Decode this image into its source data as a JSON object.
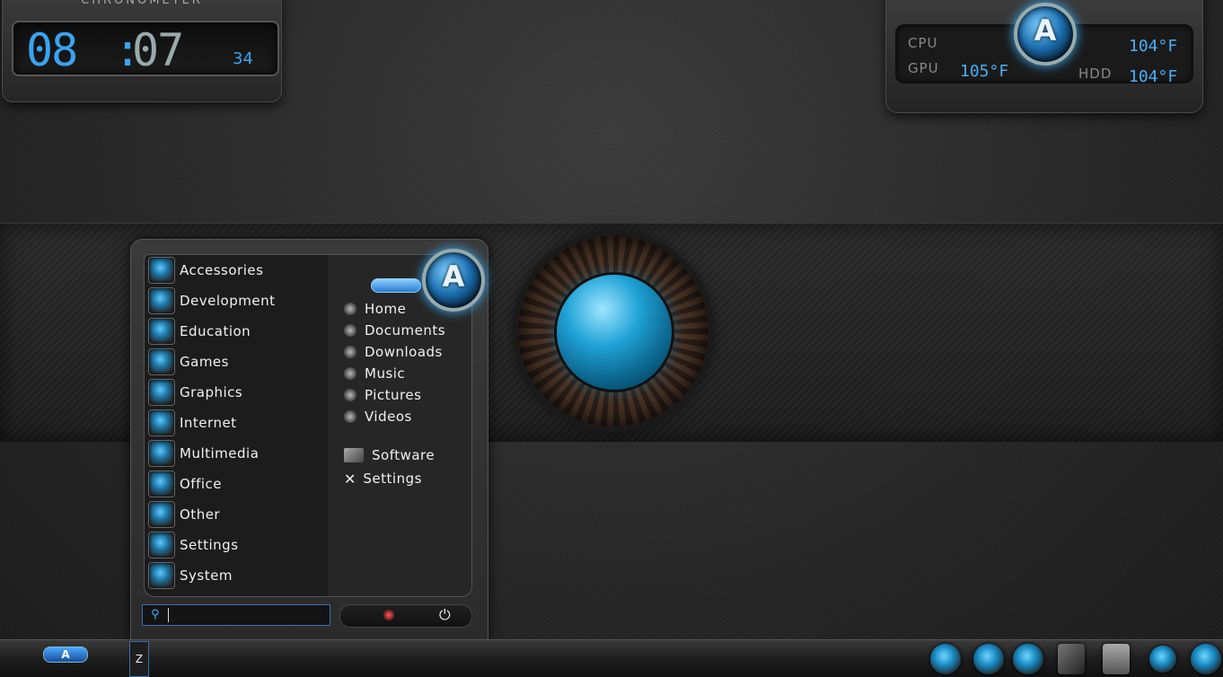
{
  "clock": {
    "title": "CHRONOMETER",
    "hours": "08",
    "separator": ":",
    "minutes": "07",
    "seconds": "34"
  },
  "temps": {
    "cpu_label": "CPU",
    "cpu_value": "104°F",
    "gpu_label": "GPU",
    "gpu_value": "105°F",
    "hdd_label": "HDD",
    "hdd_value": "104°F",
    "logo_letter": "A"
  },
  "menu": {
    "categories": [
      {
        "label": "Accessories",
        "icon": "accessories-icon"
      },
      {
        "label": "Development",
        "icon": "development-icon"
      },
      {
        "label": "Education",
        "icon": "education-icon"
      },
      {
        "label": "Games",
        "icon": "gamepad-icon"
      },
      {
        "label": "Graphics",
        "icon": "graphics-icon"
      },
      {
        "label": "Internet",
        "icon": "internet-icon"
      },
      {
        "label": "Multimedia",
        "icon": "multimedia-icon"
      },
      {
        "label": "Office",
        "icon": "office-icon"
      },
      {
        "label": "Other",
        "icon": "gear-icon"
      },
      {
        "label": "Settings",
        "icon": "settings-icon"
      },
      {
        "label": "System",
        "icon": "system-icon"
      }
    ],
    "places": [
      {
        "label": "Home",
        "icon": "home-icon"
      },
      {
        "label": "Documents",
        "icon": "documents-icon"
      },
      {
        "label": "Downloads",
        "icon": "downloads-icon"
      },
      {
        "label": "Music",
        "icon": "music-icon"
      },
      {
        "label": "Pictures",
        "icon": "pictures-icon"
      },
      {
        "label": "Videos",
        "icon": "videos-icon"
      }
    ],
    "software_label": "Software",
    "settings_label": "Settings",
    "logo_letter": "A",
    "search_placeholder": ""
  },
  "taskbar": {
    "start_letter": "A",
    "launcher_glyph": "Z"
  },
  "colors": {
    "accent": "#3aa3f0",
    "text": "#f0f0f0"
  }
}
